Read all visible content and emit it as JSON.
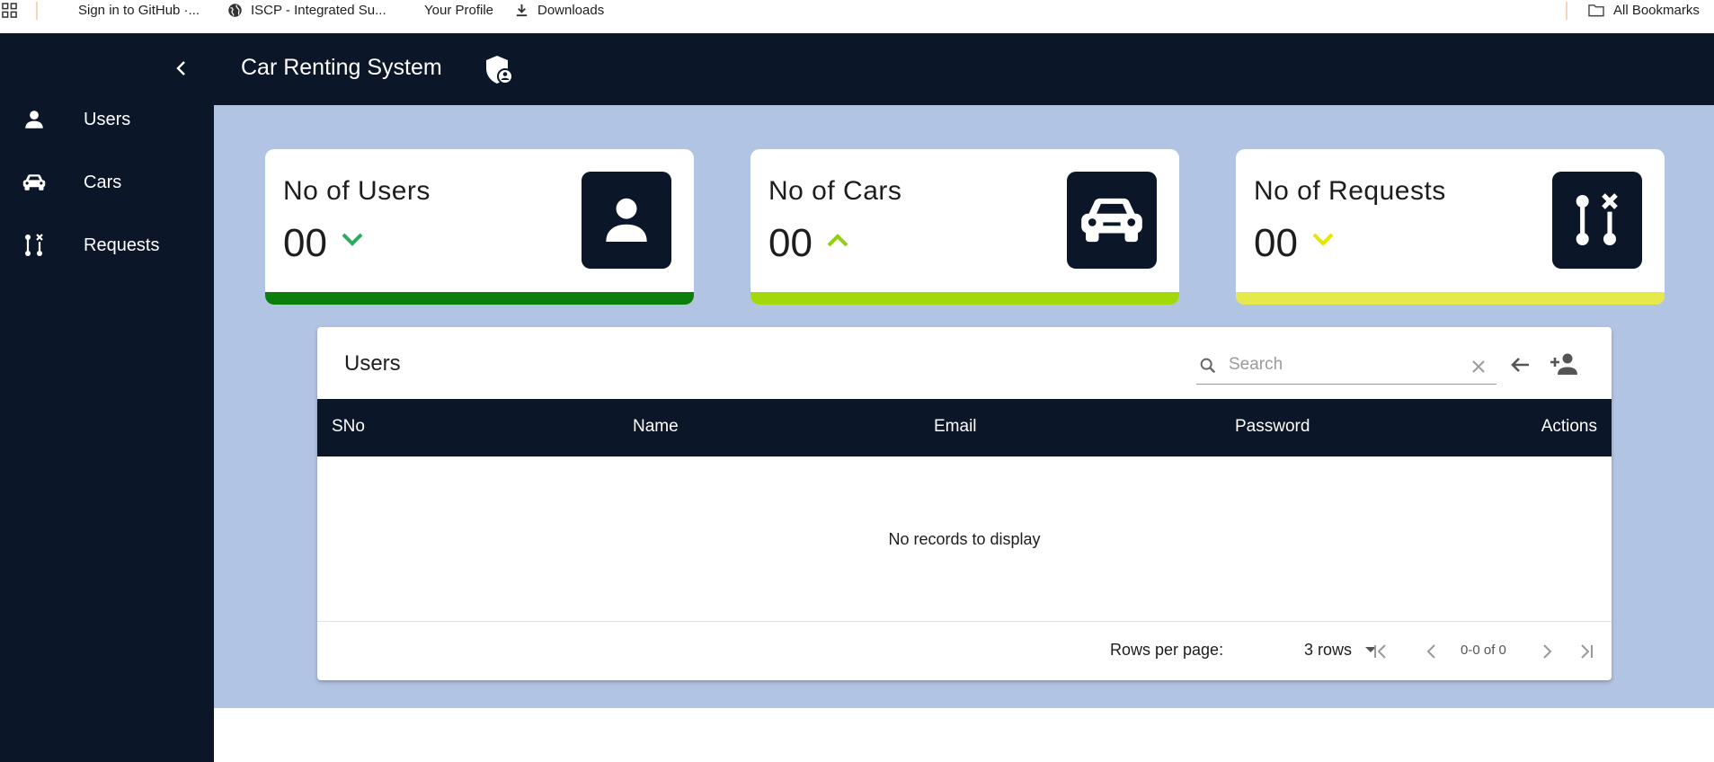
{
  "bookmarks": {
    "items": [
      {
        "label": "Sign in to GitHub ·...",
        "icon": "github-icon"
      },
      {
        "label": "ISCP - Integrated Su...",
        "icon": "globe-icon"
      },
      {
        "label": "Your Profile",
        "icon": "profile-icon"
      },
      {
        "label": "Downloads",
        "icon": "download-icon"
      }
    ],
    "all_bookmarks": "All Bookmarks"
  },
  "sidebar": {
    "items": [
      {
        "label": "Users",
        "icon": "person-icon"
      },
      {
        "label": "Cars",
        "icon": "car-icon"
      },
      {
        "label": "Requests",
        "icon": "route-icon"
      }
    ]
  },
  "header": {
    "title": "Car Renting System",
    "icon": "admin-shield-icon"
  },
  "stats": [
    {
      "title": "No of Users",
      "value": "00",
      "trend": "down",
      "accent": "#0b7f0b",
      "icon": "person-icon"
    },
    {
      "title": "No of Cars",
      "value": "00",
      "trend": "up",
      "accent": "#a3d80a",
      "icon": "car-icon"
    },
    {
      "title": "No of Requests",
      "value": "00",
      "trend": "down",
      "accent": "#e6e94a",
      "icon": "route-icon"
    }
  ],
  "table": {
    "title": "Users",
    "search_placeholder": "Search",
    "columns": [
      "SNo",
      "Name",
      "Email",
      "Password",
      "Actions"
    ],
    "empty_message": "No records to display",
    "rows_per_page_label": "Rows per page:",
    "rows_per_page_value": "3 rows",
    "page_info": "0-0 of 0"
  },
  "colors": {
    "navy": "#0b1629",
    "background": "#b2c4e3",
    "users_arrow": "#2eaa5e",
    "cars_arrow": "#8fd10a",
    "requests_arrow": "#e8e600"
  }
}
